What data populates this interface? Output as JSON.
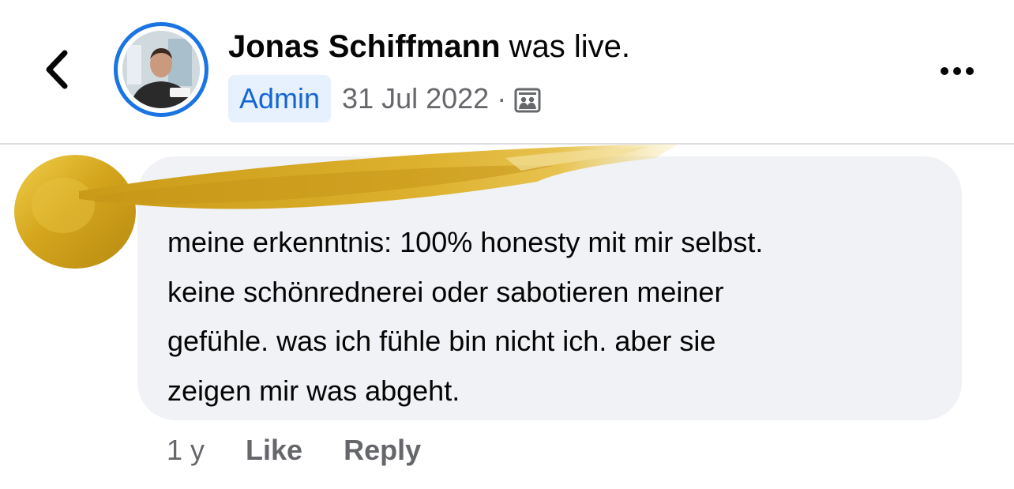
{
  "header": {
    "author_name": "Jonas Schiffmann",
    "action_text": "was live.",
    "badge": "Admin",
    "date": "31 Jul 2022",
    "separator": "·",
    "audience_icon": "group-icon"
  },
  "comment": {
    "lines": [
      "meine erkenntnis: 100% honesty mit mir selbst.",
      "keine schönrednerei oder sabotieren meiner",
      "gefühle. was ich fühle bin nicht ich. aber sie",
      "zeigen mir was abgeht."
    ],
    "time": "1 y",
    "like_label": "Like",
    "reply_label": "Reply"
  },
  "colors": {
    "accent": "#1b74e4",
    "badge_bg": "#e7f0fd",
    "bubble_bg": "#f0f2f5",
    "muted_text": "#65676b",
    "gold": "#d9ab1f"
  },
  "icons": {
    "back": "chevron-left-icon",
    "more": "more-horizontal-icon"
  }
}
